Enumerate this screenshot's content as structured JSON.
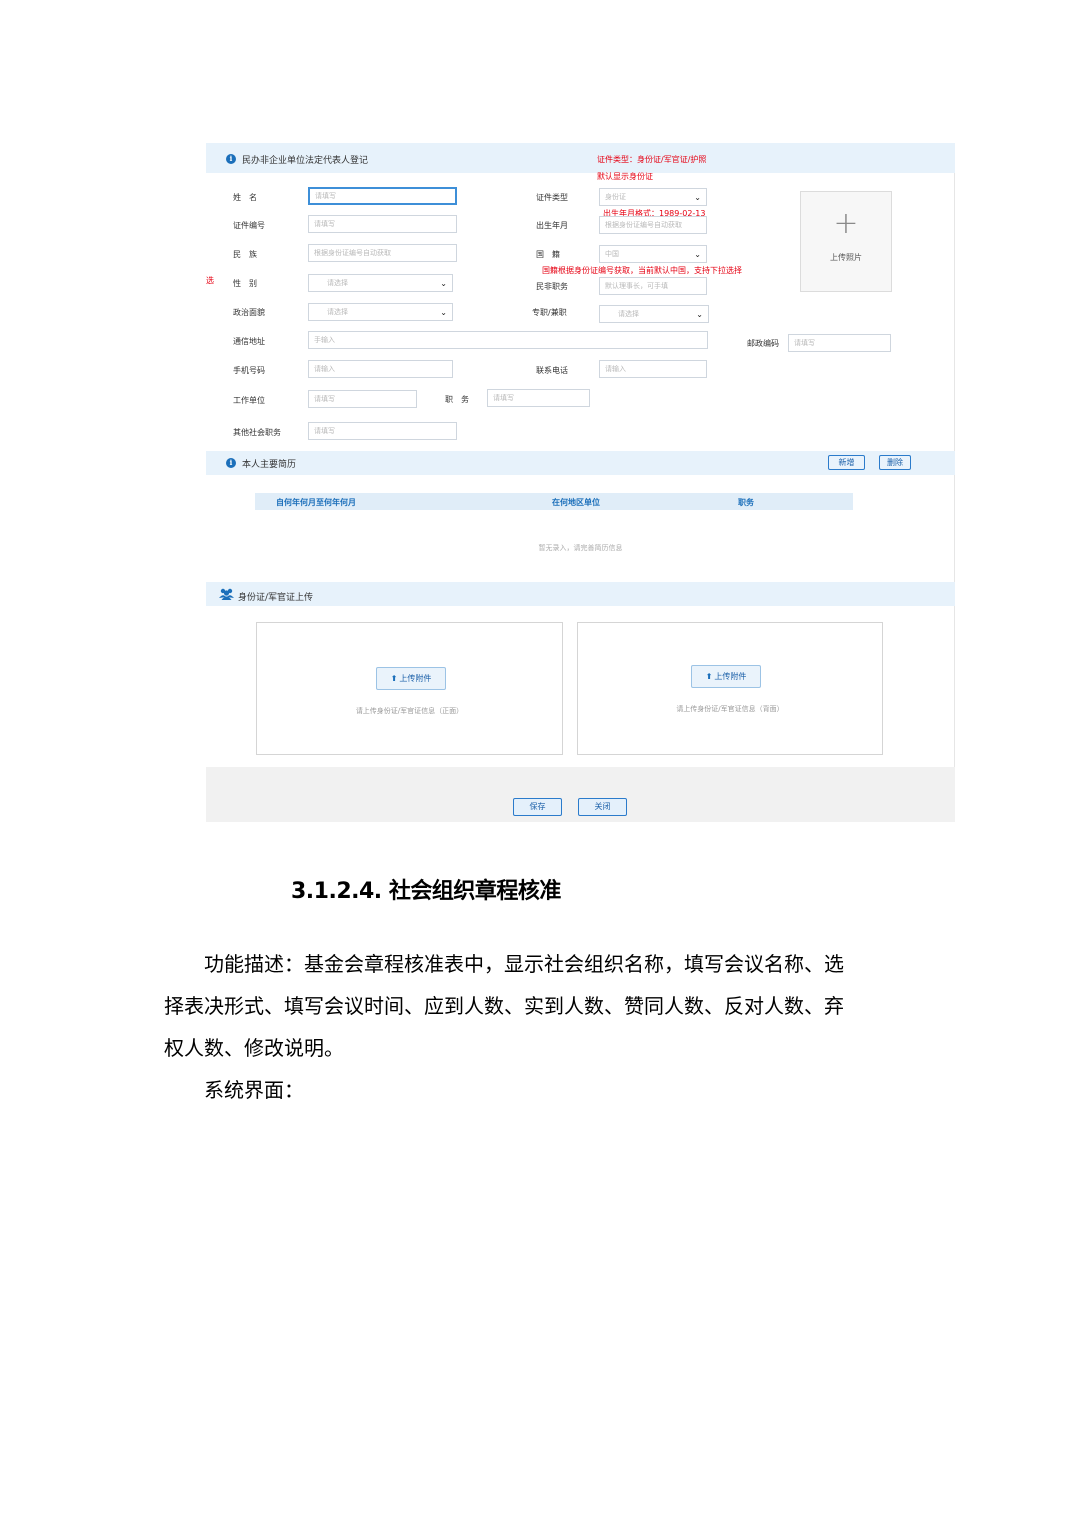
{
  "form": {
    "section_title": "民办非企业单位法定代表人登记",
    "info_glyph": "i",
    "notes": {
      "id_type": "证件类型：身份证/军官证/护照",
      "id_default": "默认显示身份证",
      "birth_format": "出生年月格式：1989-02-13",
      "nationality": "国籍根据身份证编号获取，当前默认中国，支持下拉选择",
      "side_mark": "选"
    },
    "labels": {
      "name": "姓　名",
      "id_no": "证件编号",
      "ethnicity": "民　族",
      "gender": "性　别",
      "politics": "政治面貌",
      "address": "通信地址",
      "mobile": "手机号码",
      "employer": "工作单位",
      "position": "职　务",
      "other_roles": "其他社会职务",
      "id_type": "证件类型",
      "birth": "出生年月",
      "nationality": "国　籍",
      "org_role": "民非职务",
      "fulltime": "专职/兼职",
      "postcode": "邮政编码",
      "phone": "联系电话"
    },
    "placeholders": {
      "name": "请填写",
      "id_no": "请填写",
      "ethnicity": "根据身份证编号自动获取",
      "gender": "请选择",
      "politics": "请选择",
      "address": "手输入",
      "mobile": "请输入",
      "employer": "请填写",
      "position": "请填写",
      "other_roles": "请填写",
      "id_type": "身份证",
      "birth": "根据身份证编号自动获取",
      "nationality": "中国",
      "org_role": "默认理事长，可手填",
      "fulltime": "请选择",
      "postcode": "请填写",
      "phone": "请输入"
    },
    "caret": "⌄",
    "photo": {
      "plus": "+",
      "label": "上传照片"
    }
  },
  "resume": {
    "section_title": "本人主要简历",
    "add_button": "新增",
    "delete_button": "删除",
    "columns": [
      "自何年何月至何年何月",
      "在何地区单位",
      "职务"
    ],
    "empty_text": "暂无录入，请完善简历信息"
  },
  "upload": {
    "section_title": "身份证/军官证上传",
    "button_label": "上传附件",
    "arrow": "⬆",
    "front_hint": "请上传身份证/军官证信息（正面）",
    "back_hint": "请上传身份证/军官证信息（背面）"
  },
  "footer": {
    "save": "保存",
    "close": "关闭"
  },
  "doc": {
    "heading": "3.1.2.4.  社会组织章程核准",
    "para1_line1": "　　功能描述：基金会章程核准表中，显示社会组织名称，填写会议名称、选",
    "para1_line2": "择表决形式、填写会议时间、应到人数、实到人数、赞同人数、反对人数、弃",
    "para1_line3": "权人数、修改说明。",
    "para2": "　　系统界面："
  }
}
